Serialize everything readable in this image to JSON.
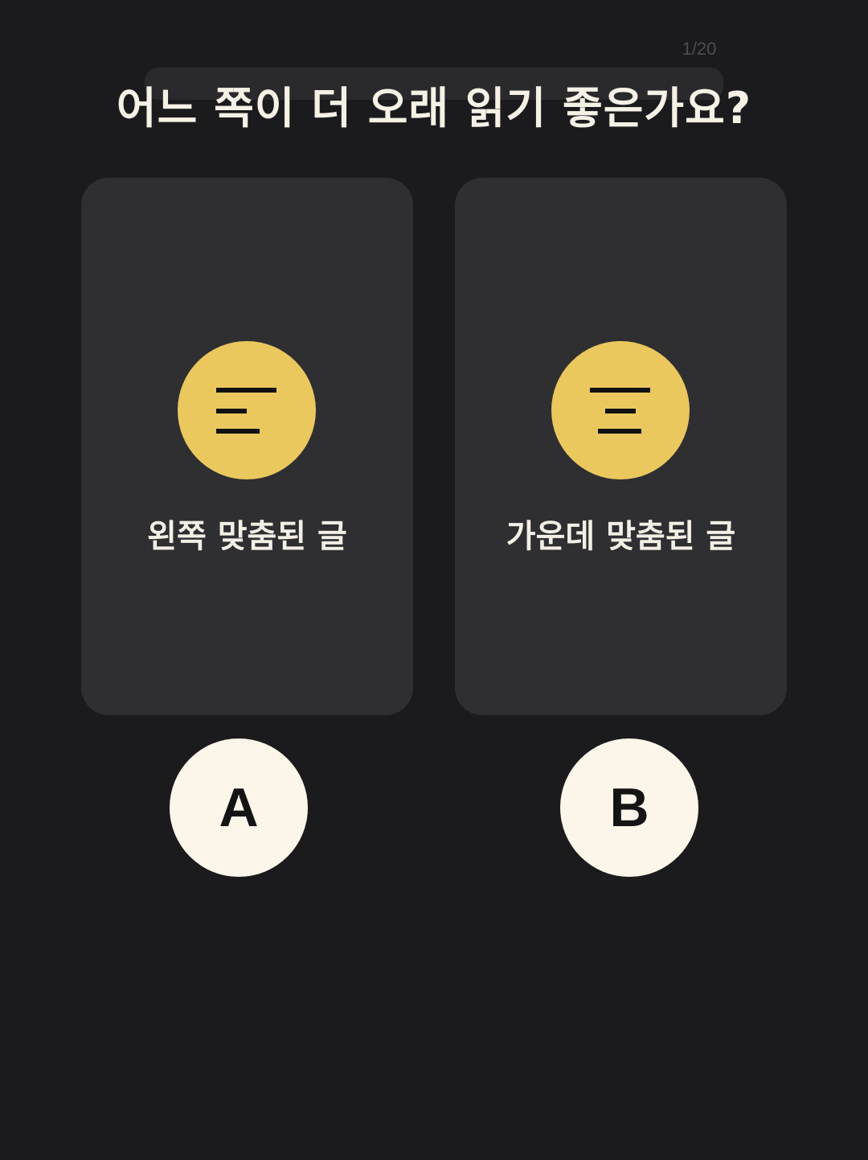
{
  "progress": {
    "label": "1/20"
  },
  "question": {
    "text": "어느 쪽이 더 오래 읽기 좋은가요?"
  },
  "options": [
    {
      "label": "왼쪽 맞춤된 글",
      "icon": "align-left-icon",
      "choice": "A"
    },
    {
      "label": "가운데 맞춤된 글",
      "icon": "align-center-icon",
      "choice": "B"
    }
  ],
  "colors": {
    "background": "#1b1b1d",
    "card": "#2f2f32",
    "accent": "#eac85e",
    "choice_button": "#fcf6ea"
  }
}
